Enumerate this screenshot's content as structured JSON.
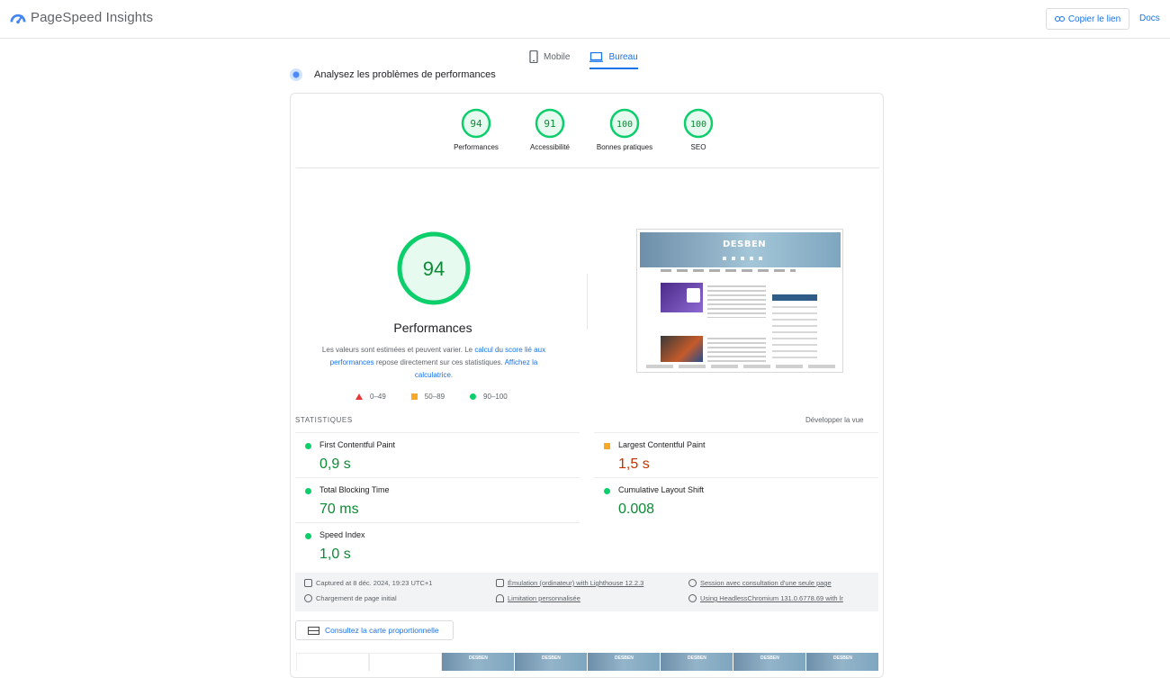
{
  "header": {
    "app_title": "PageSpeed Insights",
    "copy_link_label": "Copier le lien",
    "docs_label": "Docs"
  },
  "device_tabs": [
    {
      "label": "Mobile",
      "icon": "phone-icon",
      "active": false
    },
    {
      "label": "Bureau",
      "icon": "desktop-icon",
      "active": true
    }
  ],
  "analyze_label": "Analysez les problèmes de performances",
  "categories": [
    {
      "label": "Performances",
      "score": "94"
    },
    {
      "label": "Accessibilité",
      "score": "91"
    },
    {
      "label": "Bonnes pratiques",
      "score": "100"
    },
    {
      "label": "SEO",
      "score": "100"
    }
  ],
  "main_score": {
    "score": "94",
    "title": "Performances",
    "desc_prefix": "Les valeurs sont estimées et peuvent varier. Le ",
    "desc_link1": "calcul du score lié aux performances",
    "desc_middle": " repose directement sur ces statistiques. ",
    "desc_link2": "Affichez la calculatrice",
    "desc_suffix": "."
  },
  "legend": [
    {
      "range": "0–49",
      "shape": "triangle",
      "color": "#e53935"
    },
    {
      "range": "50–89",
      "shape": "square",
      "color": "#f9a825"
    },
    {
      "range": "90–100",
      "shape": "circle",
      "color": "#0cce6b"
    }
  ],
  "screenshot": {
    "site_logo": "DESBEN"
  },
  "stats": {
    "title": "STATISTIQUES",
    "expand_label": "Développer la vue",
    "metrics": [
      {
        "name": "First Contentful Paint",
        "value": "0,9 s",
        "status": "good"
      },
      {
        "name": "Largest Contentful Paint",
        "value": "1,5 s",
        "status": "average"
      },
      {
        "name": "Total Blocking Time",
        "value": "70 ms",
        "status": "good"
      },
      {
        "name": "Cumulative Layout Shift",
        "value": "0.008",
        "status": "good"
      },
      {
        "name": "Speed Index",
        "value": "1,0 s",
        "status": "good"
      }
    ]
  },
  "environment": [
    {
      "text": "Captured at 8 déc. 2024, 19:23 UTC+1",
      "icon": "calendar-icon"
    },
    {
      "text": "Émulation (ordinateur) with Lighthouse 12.2.3",
      "icon": "laptop-icon"
    },
    {
      "text": "Session avec consultation d'une seule page",
      "icon": "users-icon"
    },
    {
      "text": "Chargement de page initial",
      "icon": "timer-icon"
    },
    {
      "text": "Limitation personnalisée",
      "icon": "wifi-icon"
    },
    {
      "text": "Using HeadlessChromium 131.0.6778.69 with lr",
      "icon": "chrome-icon"
    }
  ],
  "treemap_label": "Consultez la carte proportionnelle",
  "colors": {
    "accent": "#1a73e8",
    "good": "#0cce6b",
    "good_text": "#0d8a36",
    "average": "#f9a825",
    "average_text": "#c33300"
  }
}
